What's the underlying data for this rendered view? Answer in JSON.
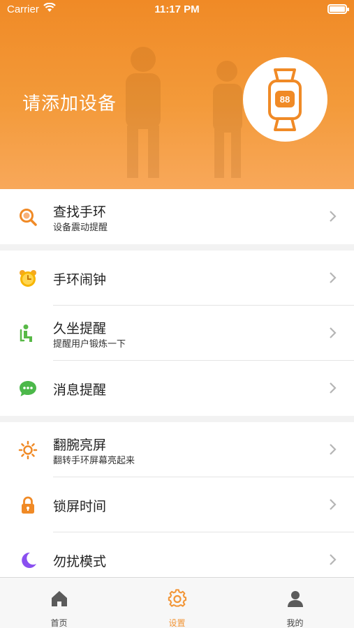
{
  "status_bar": {
    "carrier": "Carrier",
    "time": "11:17 PM"
  },
  "header": {
    "title": "请添加设备",
    "device_icon": "band-watch-icon",
    "accent": "#f08a26"
  },
  "groups": [
    {
      "items": [
        {
          "title": "查找手环",
          "subtitle": "设备震动提醒",
          "icon": "search-icon"
        }
      ]
    },
    {
      "items": [
        {
          "title": "手环闹钟",
          "subtitle": "",
          "icon": "alarm-clock-icon"
        },
        {
          "title": "久坐提醒",
          "subtitle": "提醒用户锻炼一下",
          "icon": "sitting-person-icon"
        },
        {
          "title": "消息提醒",
          "subtitle": "",
          "icon": "message-icon"
        }
      ]
    },
    {
      "items": [
        {
          "title": "翻腕亮屏",
          "subtitle": "翻转手环屏幕亮起来",
          "icon": "brightness-icon"
        },
        {
          "title": "锁屏时间",
          "subtitle": "",
          "icon": "lock-icon"
        },
        {
          "title": "勿扰模式",
          "subtitle": "",
          "icon": "moon-icon"
        }
      ]
    }
  ],
  "tabbar": {
    "tabs": [
      {
        "label": "首页",
        "icon": "home-icon",
        "active": false
      },
      {
        "label": "设置",
        "icon": "gear-icon",
        "active": true
      },
      {
        "label": "我的",
        "icon": "person-icon",
        "active": false
      }
    ]
  }
}
